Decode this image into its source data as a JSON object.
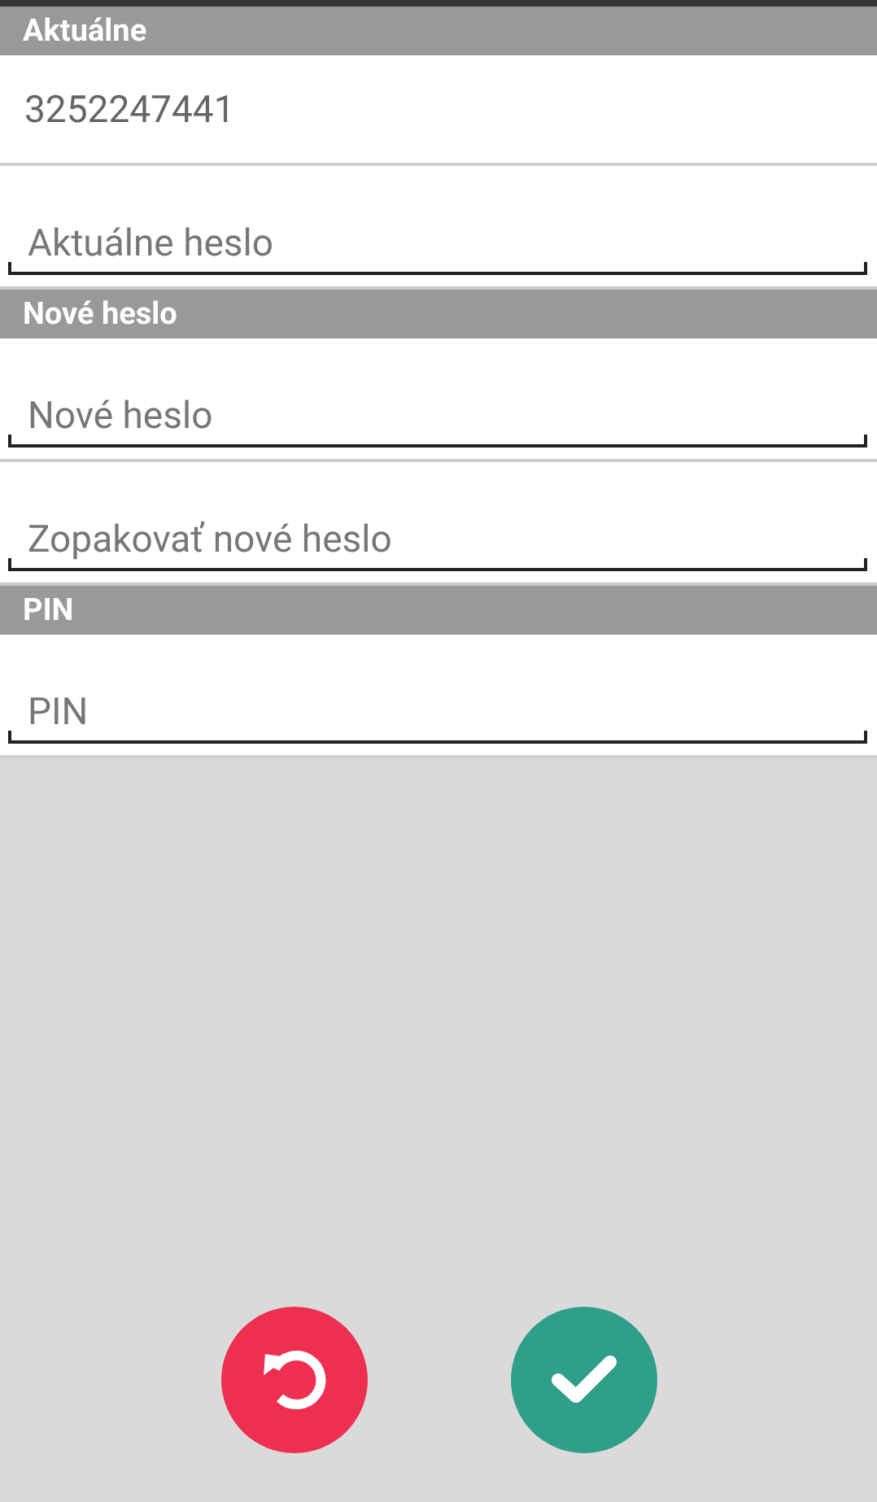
{
  "sections": [
    {
      "title": "Aktuálne",
      "rows": [
        {
          "kind": "value",
          "text": "3252247441"
        },
        {
          "kind": "field",
          "placeholder": "Aktuálne heslo"
        }
      ]
    },
    {
      "title": "Nové heslo",
      "rows": [
        {
          "kind": "field",
          "placeholder": "Nové heslo"
        },
        {
          "kind": "field",
          "placeholder": "Zopakovať nové heslo"
        }
      ]
    },
    {
      "title": "PIN",
      "rows": [
        {
          "kind": "field",
          "placeholder": "PIN"
        }
      ]
    }
  ],
  "buttons": [
    {
      "kind": "reset",
      "color": "#ee2f4f"
    },
    {
      "kind": "confirm",
      "color": "#2f9f8a"
    }
  ]
}
